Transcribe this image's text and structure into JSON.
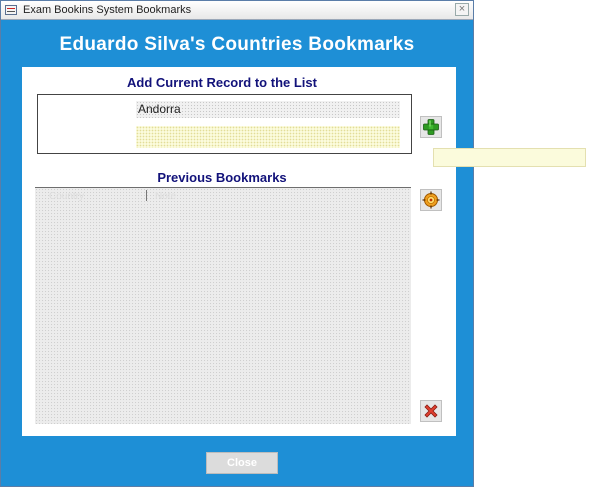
{
  "window": {
    "title": "Exam Bookins System Bookmarks",
    "close_symbol": "×"
  },
  "form": {
    "heading": "Eduardo Silva's Countries Bookmarks"
  },
  "add_section": {
    "label": "Add Current Record to the List",
    "current_record": "Andorra",
    "note_value": "",
    "add_icon": "plus-icon"
  },
  "bookmarks_section": {
    "label": "Previous Bookmarks",
    "column_headers": [
      "Country",
      "Note"
    ],
    "items": [],
    "goto_icon": "goto-target-icon",
    "delete_icon": "delete-x-icon"
  },
  "footer": {
    "close_label": "Close"
  },
  "colors": {
    "form_background": "#1e8fd6",
    "heading_text": "#ffffff",
    "section_label": "#12127a",
    "note_field": "#fbfbdc"
  }
}
